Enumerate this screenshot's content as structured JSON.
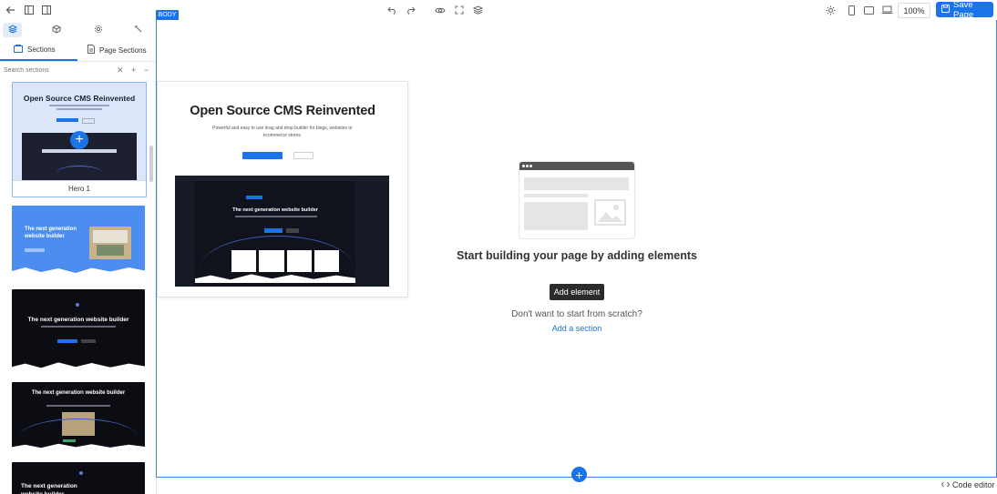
{
  "toolbar": {
    "zoom": "100%",
    "save_label": "Save Page"
  },
  "canvas": {
    "body_tag": "BODY",
    "empty_title": "Start building your page by adding elements",
    "add_element_label": "Add element",
    "scratch_text": "Don't want to start from scratch?",
    "add_section_label": "Add a section"
  },
  "left_panel": {
    "tabs": [
      {
        "icon": "layers-icon"
      },
      {
        "icon": "cube-icon"
      },
      {
        "icon": "gear-icon"
      },
      {
        "icon": "wrench-icon"
      }
    ],
    "section_tabs": [
      "Sections",
      "Page Sections"
    ],
    "search_placeholder": "Search sections",
    "cards": [
      {
        "label": "Hero 1",
        "title": "Open Source CMS Reinvented"
      },
      {
        "title": "The next generation website builder"
      },
      {
        "title": "The next generation website builder"
      },
      {
        "title": "The next generation website builder"
      },
      {
        "title": "The next generation website builder"
      }
    ]
  },
  "preview": {
    "title": "Open Source CMS Reinvented",
    "subtitle": "Powerful and easy to use drag and drop builder for blogs, websites or ecommerce stores.",
    "inner_heading": "The next generation website builder"
  },
  "footer": {
    "code_editor_label": "Code editor"
  },
  "colors": {
    "accent": "#1a73e8",
    "canvas_border": "#3b82f6"
  }
}
